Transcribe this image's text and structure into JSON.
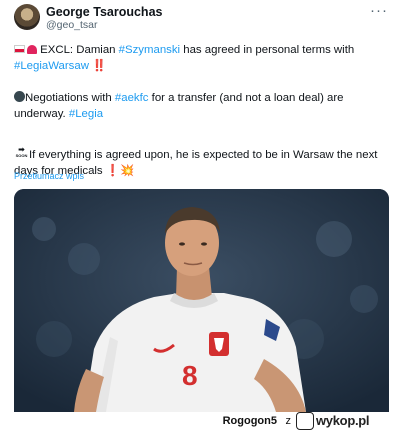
{
  "author": {
    "name": "George Tsarouchas",
    "handle": "@geo_tsar"
  },
  "tweet": {
    "line1_prefix": "EXCL: Damian ",
    "tag_szymanski": "#Szymanski",
    "line1_mid": " has agreed in personal terms with ",
    "tag_legiawarsaw": "#LegiaWarsaw",
    "line1_emoji": "‼️",
    "line2_prefix": "Negotiations with ",
    "tag_aekfc": "#aekfc",
    "line2_mid": " for a transfer (and not a loan deal) are underway. ",
    "tag_legia": "#Legia",
    "line3_soon": "SOON",
    "line3_text": "If everything is agreed upon, he is expected to be in Warsaw the next days for medicals ",
    "line3_emoji": "❗💥",
    "translate_link": "Przetłumacz wpis"
  },
  "media": {
    "shirt_number": "8"
  },
  "footer": {
    "username": "Rogogon5",
    "z": "z",
    "site_logo": "wykop.pl"
  },
  "colors": {
    "link": "#1d9bf0",
    "text": "#0f1419",
    "muted": "#536471"
  }
}
